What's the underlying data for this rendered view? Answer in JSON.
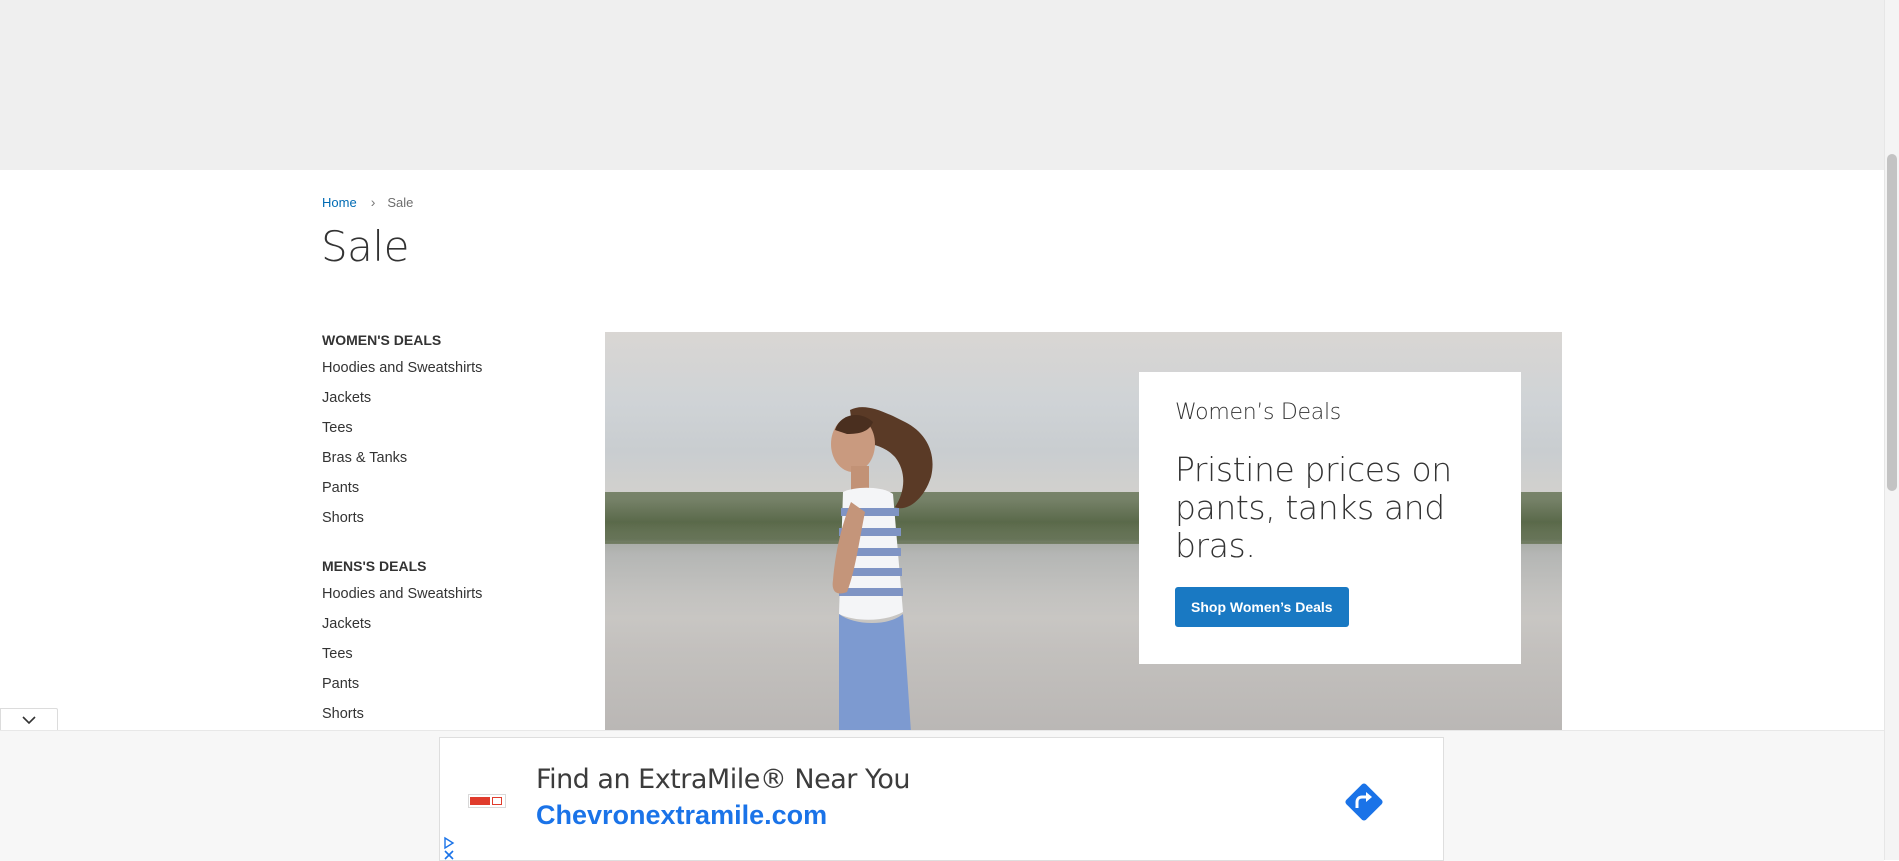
{
  "breadcrumb": {
    "home": "Home",
    "separator": "›",
    "current": "Sale"
  },
  "page": {
    "title": "Sale"
  },
  "sidebar": {
    "groups": [
      {
        "title": "WOMEN'S DEALS",
        "items": [
          "Hoodies and Sweatshirts",
          "Jackets",
          "Tees",
          "Bras & Tanks",
          "Pants",
          "Shorts"
        ]
      },
      {
        "title": "MENS'S DEALS",
        "items": [
          "Hoodies and Sweatshirts",
          "Jackets",
          "Tees",
          "Pants",
          "Shorts"
        ]
      }
    ]
  },
  "promo": {
    "kicker": "Women’s Deals",
    "headline": "Pristine prices on pants, tanks and bras.",
    "cta_label": "Shop Women’s Deals"
  },
  "ad": {
    "title": "Find an ExtraMile® Near You",
    "url": "Chevronextramile.com",
    "icons": [
      "adchoices-icon",
      "close-icon",
      "directions-arrow-icon",
      "chevron-down-icon"
    ]
  },
  "colors": {
    "accent": "#1979c3",
    "link": "#006bb4",
    "ad_link": "#1a73e8",
    "top_band": "#efefef"
  }
}
